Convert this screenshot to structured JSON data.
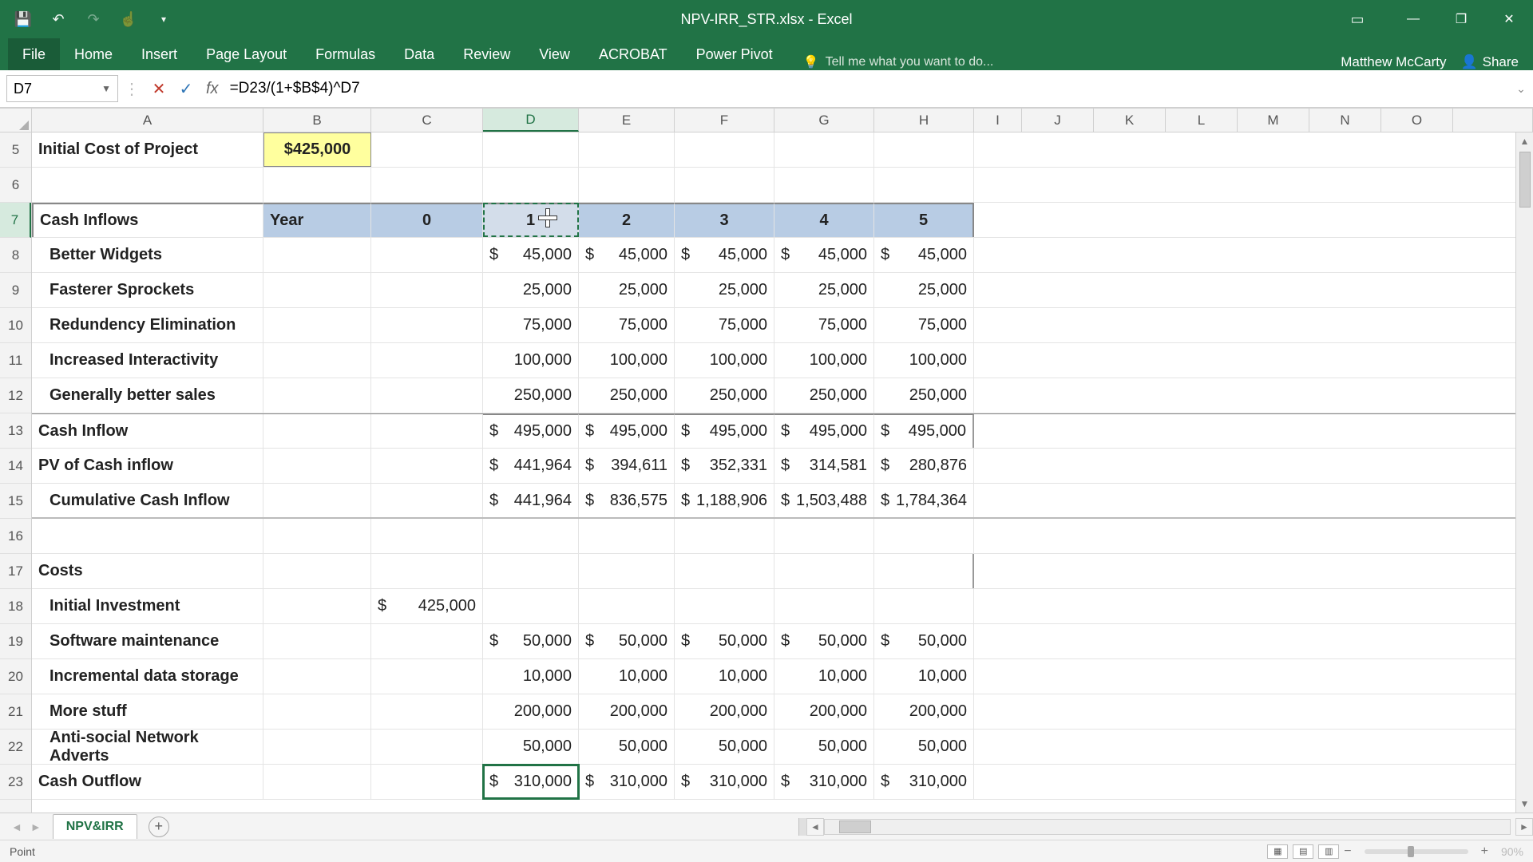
{
  "window": {
    "title": "NPV-IRR_STR.xlsx - Excel",
    "account": "Matthew McCarty",
    "share_label": "Share"
  },
  "ribbon": {
    "tabs": [
      "File",
      "Home",
      "Insert",
      "Page Layout",
      "Formulas",
      "Data",
      "Review",
      "View",
      "ACROBAT",
      "Power Pivot"
    ],
    "tell_me": "Tell me what you want to do..."
  },
  "formula_bar": {
    "name_box": "D7",
    "formula": "=D23/(1+$B$4)^D7"
  },
  "columns": [
    "A",
    "B",
    "C",
    "D",
    "E",
    "F",
    "G",
    "H",
    "I",
    "J",
    "K",
    "L",
    "M",
    "N",
    "O"
  ],
  "row_numbers": [
    "5",
    "6",
    "7",
    "8",
    "9",
    "10",
    "11",
    "12",
    "13",
    "14",
    "15",
    "16",
    "17",
    "18",
    "19",
    "20",
    "21",
    "22",
    "23"
  ],
  "sheet": {
    "active_tab": "NPV&IRR"
  },
  "status": {
    "mode": "Point",
    "zoom": "90%"
  },
  "data": {
    "initial_cost_label": "Initial Cost of Project",
    "initial_cost_value": "$425,000",
    "cash_inflows_label": "Cash Inflows",
    "year_label": "Year",
    "years": [
      "0",
      "1",
      "2",
      "3",
      "4",
      "5"
    ],
    "inflow_rows": [
      {
        "label": "Better Widgets",
        "money": true,
        "vals": [
          "45,000",
          "45,000",
          "45,000",
          "45,000",
          "45,000"
        ]
      },
      {
        "label": "Fasterer Sprockets",
        "money": false,
        "vals": [
          "25,000",
          "25,000",
          "25,000",
          "25,000",
          "25,000"
        ]
      },
      {
        "label": "Redundency Elimination",
        "money": false,
        "vals": [
          "75,000",
          "75,000",
          "75,000",
          "75,000",
          "75,000"
        ]
      },
      {
        "label": "Increased Interactivity",
        "money": false,
        "vals": [
          "100,000",
          "100,000",
          "100,000",
          "100,000",
          "100,000"
        ]
      },
      {
        "label": "Generally better sales",
        "money": false,
        "vals": [
          "250,000",
          "250,000",
          "250,000",
          "250,000",
          "250,000"
        ]
      }
    ],
    "cash_inflow_total_label": "Cash Inflow",
    "cash_inflow_total": [
      "495,000",
      "495,000",
      "495,000",
      "495,000",
      "495,000"
    ],
    "pv_label": "PV of Cash inflow",
    "pv_vals": [
      "441,964",
      "394,611",
      "352,331",
      "314,581",
      "280,876"
    ],
    "cum_label": "Cumulative Cash Inflow",
    "cum_vals": [
      "441,964",
      "836,575",
      "1,188,906",
      "1,503,488",
      "1,784,364"
    ],
    "costs_label": "Costs",
    "initial_investment_label": "Initial Investment",
    "initial_investment_value": "425,000",
    "cost_rows": [
      {
        "label": "Software maintenance",
        "money": true,
        "vals": [
          "50,000",
          "50,000",
          "50,000",
          "50,000",
          "50,000"
        ]
      },
      {
        "label": "Incremental data storage",
        "money": false,
        "vals": [
          "10,000",
          "10,000",
          "10,000",
          "10,000",
          "10,000"
        ]
      },
      {
        "label": "More stuff",
        "money": false,
        "vals": [
          "200,000",
          "200,000",
          "200,000",
          "200,000",
          "200,000"
        ]
      },
      {
        "label": "Anti-social Network Adverts",
        "money": false,
        "vals": [
          "50,000",
          "50,000",
          "50,000",
          "50,000",
          "50,000"
        ]
      }
    ],
    "cash_outflow_label": "Cash Outflow",
    "cash_outflow_vals": [
      "310,000",
      "310,000",
      "310,000",
      "310,000",
      "310,000"
    ]
  }
}
